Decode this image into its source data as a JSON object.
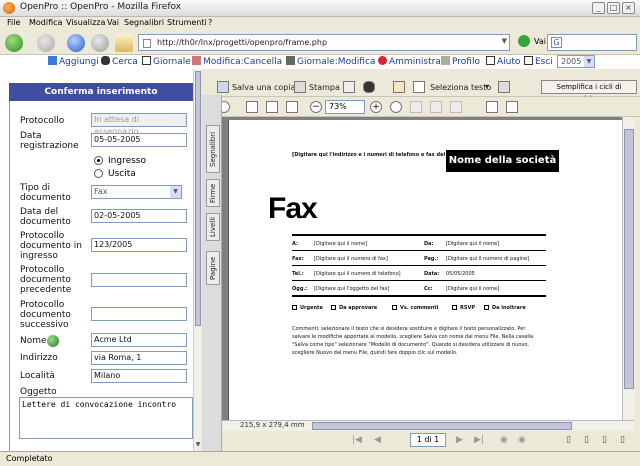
{
  "window": {
    "title": "OpenPro :: OpenPro - Mozilla Firefox"
  },
  "menu": [
    "File",
    "Modifica",
    "Visualizza",
    "Vai",
    "Segnalibri",
    "Strumenti",
    "?"
  ],
  "browser": {
    "url": "http://th0r/lnx/progetti/openpro/frame.php",
    "go_label": "Vai",
    "search_engine": "G"
  },
  "app_links": [
    {
      "label": "Aggiungi",
      "icon": "add-icon"
    },
    {
      "label": "Cerca",
      "icon": "binoculars-icon"
    },
    {
      "label": "Giornale",
      "icon": "register-icon"
    },
    {
      "label": "Modifica:Cancella",
      "icon": "edit-icon"
    },
    {
      "label": "Giornale:Modifica",
      "icon": "stamp-icon"
    },
    {
      "label": "Amministra",
      "icon": "star-icon"
    },
    {
      "label": "Profilo",
      "icon": "profile-icon"
    },
    {
      "label": "Aiuto",
      "icon": "help-icon"
    },
    {
      "label": "Esci",
      "icon": "exit-icon"
    }
  ],
  "year": "2005",
  "form": {
    "header": "Conferma inserimento",
    "fields": {
      "protocollo": {
        "label": "Protocollo",
        "value": "In attesa di assegnazio"
      },
      "data_registrazione": {
        "label": "Data registrazione",
        "value": "05-05-2005"
      },
      "direzione": {
        "options": [
          "Ingresso",
          "Uscita"
        ],
        "selected": "Ingresso"
      },
      "tipo_documento": {
        "label": "Tipo di documento",
        "value": "Fax"
      },
      "data_documento": {
        "label": "Data del documento",
        "value": "02-05-2005"
      },
      "protocollo_ingresso": {
        "label": "Protocollo documento in ingresso",
        "value": "123/2005"
      },
      "protocollo_precedente": {
        "label": "Protocollo documento precedente",
        "value": ""
      },
      "protocollo_successivo": {
        "label": "Protocollo documento successivo",
        "value": ""
      },
      "nome": {
        "label": "Nome",
        "value": "Acme Ltd"
      },
      "indirizzo": {
        "label": "Indirizzo",
        "value": "via Roma, 1"
      },
      "localita": {
        "label": "Località",
        "value": "Milano"
      },
      "oggetto": {
        "label": "Oggetto",
        "value": "Lettere di convocazione incontro"
      }
    }
  },
  "pdf_viewer": {
    "save_copy": "Salva una copia",
    "print": "Stampa",
    "select_text": "Seleziona testo",
    "zoom": "73%",
    "review_button": "Semplifica i cicli di revisione",
    "side_tabs": [
      "Segnalibri",
      "Firme",
      "Livelli",
      "Pagine"
    ],
    "page_size": "215,9 x 279,4 mm",
    "page_indicator": "1 di 1"
  },
  "fax": {
    "header_note": "[Digitare qui l'indirizzo e i numeri di telefono e fax del mittente]",
    "company": "Nome della società",
    "title": "Fax",
    "rows": [
      {
        "l1": "A:",
        "v1": "[Digitare qui il nome]",
        "l2": "Da:",
        "v2": "[Digitare qui il nome]"
      },
      {
        "l1": "Fax:",
        "v1": "[Digitare qui il numero di fax]",
        "l2": "Pag.:",
        "v2": "[Digitare qui il numero di pagine]"
      },
      {
        "l1": "Tel.:",
        "v1": "[Digitare qui il numero di telefono]",
        "l2": "Data:",
        "v2": "05/05/2005"
      },
      {
        "l1": "Ogg.:",
        "v1": "[Digitare qui l'oggetto del fax]",
        "l2": "Cc:",
        "v2": "[Digitare qui il nome]"
      }
    ],
    "checkboxes": [
      "Urgente",
      "Da approvare",
      "Vs. commenti",
      "RSVP",
      "Da inoltrare"
    ],
    "comment_lines": [
      "Commenti: selezionare il testo che si desidera sostituire e digitare il testo personalizzato. Per",
      "salvare le modifiche apportate al modello, scegliere Salva con nome dal menu File. Nella casella",
      "\"Salva come tipo\" selezionare \"Modello di documento\". Quando si desidera utilizzare di nuovo,",
      "scegliere Nuovo dal menu File, quindi fare doppio clic sul modello."
    ]
  },
  "status": "Completato"
}
